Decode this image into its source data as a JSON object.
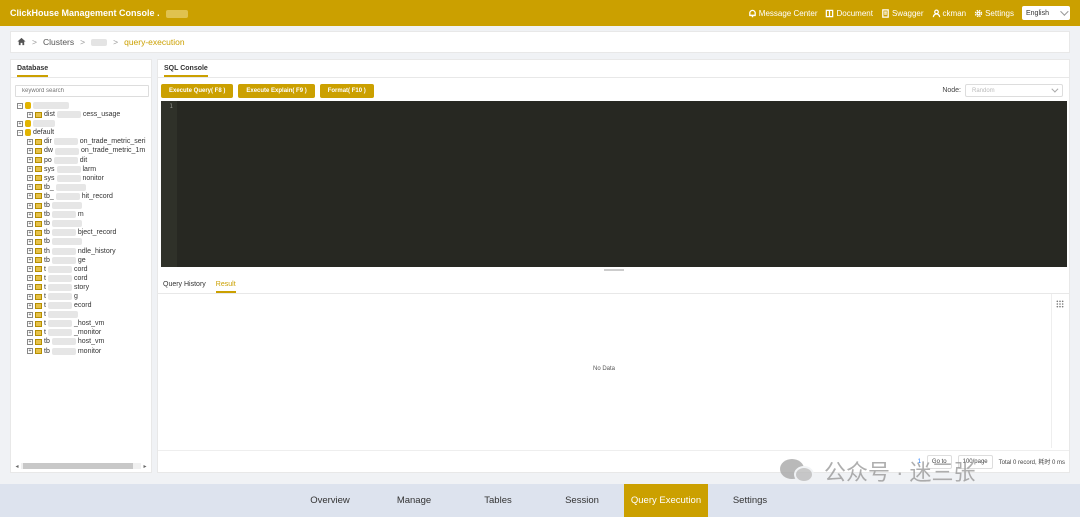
{
  "header": {
    "brand": "ClickHouse Management Console",
    "brand_suffix": ".",
    "items": [
      {
        "label": "Message Center",
        "icon": "bell-icon"
      },
      {
        "label": "Document",
        "icon": "book-icon"
      },
      {
        "label": "Swagger",
        "icon": "doc-icon"
      },
      {
        "label": "ckman",
        "icon": "user-icon"
      },
      {
        "label": "Settings",
        "icon": "gear-icon"
      }
    ],
    "language": "English"
  },
  "breadcrumb": {
    "home_icon": "home-icon",
    "clusters": "Clusters",
    "current": "query-execution"
  },
  "left": {
    "tab": "Database",
    "search_placeholder": "keyword search",
    "tree": [
      {
        "level": 0,
        "sign": "⊟",
        "icon": "db",
        "text": ""
      },
      {
        "level": 1,
        "sign": "⊞",
        "icon": "tbl",
        "text": "dist",
        "text2": "cess_usage"
      },
      {
        "level": 0,
        "sign": "⊞",
        "icon": "db",
        "text": ""
      },
      {
        "level": 0,
        "sign": "⊟",
        "icon": "db",
        "text": "default"
      },
      {
        "level": 1,
        "sign": "⊞",
        "icon": "tbl",
        "text": "dir",
        "text2": "on_trade_metric_seri"
      },
      {
        "level": 1,
        "sign": "⊞",
        "icon": "tbl",
        "text": "dw",
        "text2": "on_trade_metric_1m"
      },
      {
        "level": 1,
        "sign": "⊞",
        "icon": "tbl",
        "text": "po",
        "text2": "dit"
      },
      {
        "level": 1,
        "sign": "⊞",
        "icon": "tbl",
        "text": "sys",
        "text2": "larm"
      },
      {
        "level": 1,
        "sign": "⊞",
        "icon": "tbl",
        "text": "sys",
        "text2": "nonitor"
      },
      {
        "level": 1,
        "sign": "⊞",
        "icon": "tbl",
        "text": "tb_",
        "text2": ""
      },
      {
        "level": 1,
        "sign": "⊞",
        "icon": "tbl",
        "text": "tb_",
        "text2": "hit_record"
      },
      {
        "level": 1,
        "sign": "⊞",
        "icon": "tbl",
        "text": "tb",
        "text2": ""
      },
      {
        "level": 1,
        "sign": "⊞",
        "icon": "tbl",
        "text": "tb",
        "text2": "m"
      },
      {
        "level": 1,
        "sign": "⊞",
        "icon": "tbl",
        "text": "tb",
        "text2": ""
      },
      {
        "level": 1,
        "sign": "⊞",
        "icon": "tbl",
        "text": "tb",
        "text2": "bject_record"
      },
      {
        "level": 1,
        "sign": "⊞",
        "icon": "tbl",
        "text": "tb",
        "text2": ""
      },
      {
        "level": 1,
        "sign": "⊞",
        "icon": "tbl",
        "text": "th",
        "text2": "ndle_history"
      },
      {
        "level": 1,
        "sign": "⊞",
        "icon": "tbl",
        "text": "tb",
        "text2": "ge"
      },
      {
        "level": 1,
        "sign": "⊞",
        "icon": "tbl",
        "text": "t",
        "text2": "cord"
      },
      {
        "level": 1,
        "sign": "⊞",
        "icon": "tbl",
        "text": "t",
        "text2": "cord"
      },
      {
        "level": 1,
        "sign": "⊞",
        "icon": "tbl",
        "text": "t",
        "text2": "story"
      },
      {
        "level": 1,
        "sign": "⊞",
        "icon": "tbl",
        "text": "t",
        "text2": "g"
      },
      {
        "level": 1,
        "sign": "⊞",
        "icon": "tbl",
        "text": "t",
        "text2": "ecord"
      },
      {
        "level": 1,
        "sign": "⊞",
        "icon": "tbl",
        "text": "t",
        "text2": ""
      },
      {
        "level": 1,
        "sign": "⊞",
        "icon": "tbl",
        "text": "t",
        "text2": "_host_vm"
      },
      {
        "level": 1,
        "sign": "⊞",
        "icon": "tbl",
        "text": "t",
        "text2": "_monitor"
      },
      {
        "level": 1,
        "sign": "⊞",
        "icon": "tbl",
        "text": "tb",
        "text2": "host_vm"
      },
      {
        "level": 1,
        "sign": "⊞",
        "icon": "tbl",
        "text": "tb",
        "text2": "monitor"
      }
    ]
  },
  "console": {
    "tab": "SQL Console",
    "buttons": {
      "execute": "Execute Query( F8 )",
      "explain": "Execute Explain( F9 )",
      "format": "Format( F10 )"
    },
    "node_label": "Node:",
    "node_value": "Random",
    "line_number": "1"
  },
  "results": {
    "tabs": {
      "history": "Query History",
      "result": "Result"
    },
    "empty": "No Data",
    "settings_icon": "column-settings-icon"
  },
  "pager": {
    "page": "1",
    "goto": "Go to",
    "page_size": "100/page",
    "summary": "Total 0 record, 耗时 0 ms"
  },
  "bottom_nav": [
    "Overview",
    "Manage",
    "Tables",
    "Session",
    "Query Execution",
    "Settings"
  ],
  "bottom_nav_active": "Query Execution",
  "watermark": "公众号 · 迷三张",
  "colors": {
    "accent": "#cba000",
    "editor_bg": "#272822",
    "nav_bg": "#dde3ee"
  }
}
